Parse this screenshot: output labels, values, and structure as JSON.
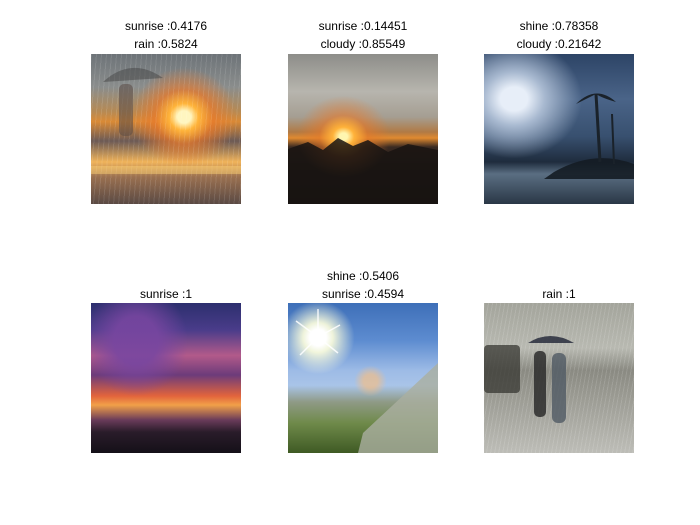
{
  "panels": [
    {
      "lines": [
        "sunrise :0.4176",
        "rain :0.5824"
      ]
    },
    {
      "lines": [
        "sunrise :0.14451",
        "cloudy :0.85549"
      ]
    },
    {
      "lines": [
        "shine :0.78358",
        "cloudy :0.21642"
      ]
    },
    {
      "lines": [
        "sunrise :1"
      ]
    },
    {
      "lines": [
        "shine :0.5406",
        "sunrise :0.4594"
      ]
    },
    {
      "lines": [
        "rain :1"
      ]
    }
  ]
}
